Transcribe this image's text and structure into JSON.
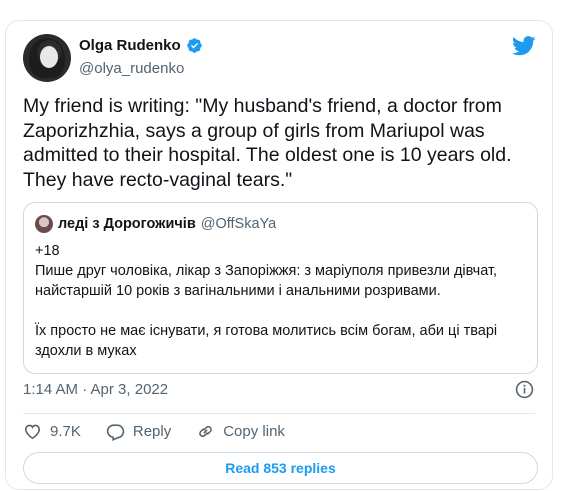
{
  "author": {
    "name": "Olga Rudenko",
    "handle": "@olya_rudenko",
    "verified": true
  },
  "tweet": {
    "text": "My friend is writing: \"My husband's friend, a doctor from Zaporizhzhia, says a group of girls from Mariupol was admitted to their hospital. The oldest one is 10 years old. They have recto-vaginal tears.\""
  },
  "quoted_tweet": {
    "name": "леді з Дорогожичів",
    "handle": "@OffSkaYa",
    "lines": [
      "+18",
      "Пише друг чоловіка, лікар з Запоріжжя: з маріуполя привезли дівчат, найстаршій 10 років з вагінальними і анальними розривами.",
      "Їх просто не має існувати, я готова молитись всім богам, аби ці тварі здохли в муках"
    ]
  },
  "meta": {
    "timestamp": "1:14 AM · Apr 3, 2022"
  },
  "actions": {
    "likes": "9.7K",
    "reply_label": "Reply",
    "copy_link_label": "Copy link"
  },
  "read_replies_label": "Read 853 replies",
  "colors": {
    "brand_blue": "#1d9bf0",
    "text_primary": "#0f1419",
    "text_secondary": "#536471",
    "border": "#cfd9de"
  },
  "icons": [
    "twitter-bird-icon",
    "verified-badge-icon",
    "info-icon",
    "heart-icon",
    "reply-icon",
    "link-icon"
  ]
}
